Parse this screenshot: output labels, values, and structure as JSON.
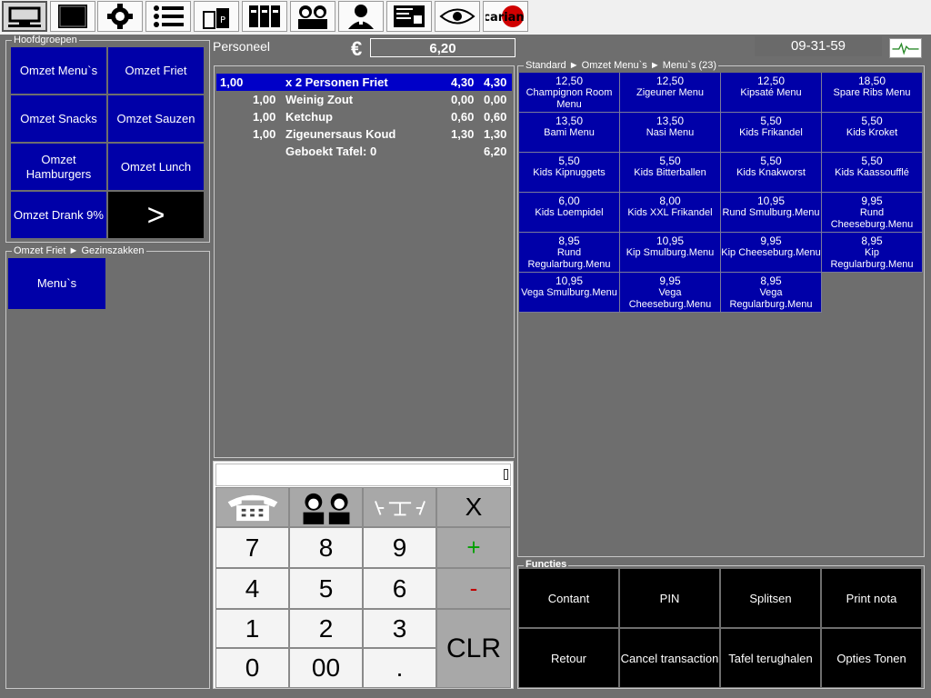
{
  "toolbar": {
    "icons": [
      "monitor-icon",
      "black-screen-icon",
      "gear-icon",
      "list-icon",
      "register-icon",
      "binders-icon",
      "staff-icon",
      "waiter-icon",
      "receipt-icon",
      "eye-icon",
      "carian-logo-icon"
    ],
    "logo_text": "carian"
  },
  "groups": {
    "legend": "Hoofdgroepen",
    "items": [
      "Omzet Menu`s",
      "Omzet Friet",
      "Omzet Snacks",
      "Omzet Sauzen",
      "Omzet Hamburgers",
      "Omzet Lunch",
      "Omzet Drank 9%"
    ],
    "next_label": ">"
  },
  "subgroups": {
    "legend": "Omzet Friet ► Gezinszakken",
    "items": [
      "Menu`s"
    ]
  },
  "header": {
    "staff_label": "Personeel",
    "currency": "€",
    "total": "6,20",
    "time": "09-31-59"
  },
  "order": {
    "rows": [
      {
        "qty": "1,00",
        "name": "x 2 Personen Friet",
        "price": "4,30",
        "total": "4,30",
        "selected": true
      },
      {
        "qty": "1,00",
        "name": "Weinig Zout",
        "price": "0,00",
        "total": "0,00"
      },
      {
        "qty": "1,00",
        "name": "Ketchup",
        "price": "0,60",
        "total": "0,60"
      },
      {
        "qty": "1,00",
        "name": "Zigeunersaus Koud",
        "price": "1,30",
        "total": "1,30"
      }
    ],
    "booked_label": "Geboekt Tafel: 0",
    "booked_total": "6,20"
  },
  "menus": {
    "legend": "Standard ► Omzet Menu`s ► Menu`s (23)",
    "items": [
      {
        "price": "12,50",
        "name": "Champignon Room Menu"
      },
      {
        "price": "12,50",
        "name": "Zigeuner Menu"
      },
      {
        "price": "12,50",
        "name": "Kipsaté Menu"
      },
      {
        "price": "18,50",
        "name": "Spare Ribs Menu"
      },
      {
        "price": "13,50",
        "name": "Bami Menu"
      },
      {
        "price": "13,50",
        "name": "Nasi Menu"
      },
      {
        "price": "5,50",
        "name": "Kids Frikandel"
      },
      {
        "price": "5,50",
        "name": "Kids Kroket"
      },
      {
        "price": "5,50",
        "name": "Kids Kipnuggets"
      },
      {
        "price": "5,50",
        "name": "Kids Bitterballen"
      },
      {
        "price": "5,50",
        "name": "Kids Knakworst"
      },
      {
        "price": "5,50",
        "name": "Kids Kaassoufflé"
      },
      {
        "price": "6,00",
        "name": "Kids Loempidel"
      },
      {
        "price": "8,00",
        "name": "Kids XXL Frikandel"
      },
      {
        "price": "10,95",
        "name": "Rund Smulburg.Menu"
      },
      {
        "price": "9,95",
        "name": "Rund Cheeseburg.Menu"
      },
      {
        "price": "8,95",
        "name": "Rund Regularburg.Menu"
      },
      {
        "price": "10,95",
        "name": "Kip Smulburg.Menu"
      },
      {
        "price": "9,95",
        "name": "Kip Cheeseburg.Menu"
      },
      {
        "price": "8,95",
        "name": "Kip Regularburg.Menu"
      },
      {
        "price": "10,95",
        "name": "Vega Smulburg.Menu"
      },
      {
        "price": "9,95",
        "name": "Vega Cheeseburg.Menu"
      },
      {
        "price": "8,95",
        "name": "Vega Regularburg.Menu"
      }
    ]
  },
  "keypad": {
    "input_value": "",
    "keys": [
      "7",
      "8",
      "9",
      "4",
      "5",
      "6",
      "1",
      "2",
      "3",
      "0",
      "00",
      "."
    ],
    "multiply": "X",
    "plus": "+",
    "minus": "-",
    "clear": "CLR",
    "plus_color": "#00a000",
    "minus_color": "#c00000"
  },
  "functions": {
    "legend": "Functies",
    "items": [
      "Contant",
      "PIN",
      "Splitsen",
      "Print nota",
      "Retour",
      "Cancel transaction",
      "Tafel terughalen",
      "Opties Tonen"
    ]
  },
  "colors": {
    "button_blue": "#0000a8",
    "selected_row": "#0000c8",
    "background": "#6e6e6e"
  }
}
